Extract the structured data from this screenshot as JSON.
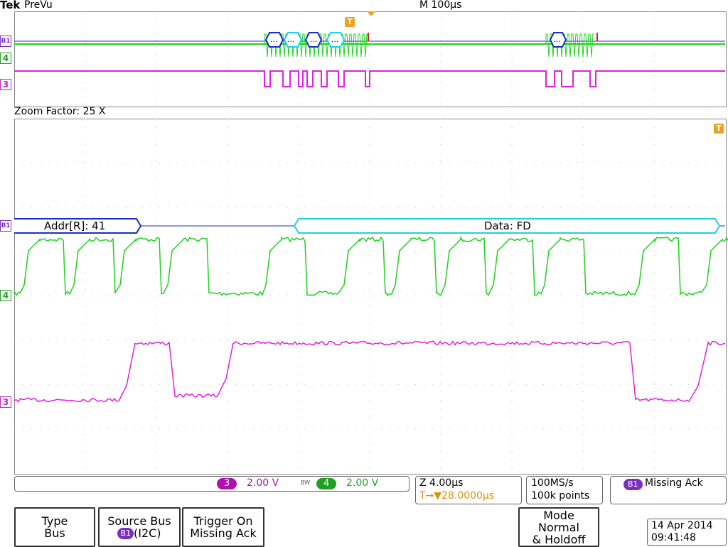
{
  "brand": "Tek",
  "mode_label": "PreVu",
  "timebase": "M 100µs",
  "zoom_factor": "Zoom Factor: 25 X",
  "channel_markers": {
    "b1": "B1",
    "ch4": "4",
    "ch3": "3",
    "trigger": "T"
  },
  "bus_labels": {
    "zoom_addr": "Addr[R]: 41",
    "zoom_data": "Data: FD",
    "overview_packets": [
      "...",
      "...",
      "...",
      "...",
      "..."
    ]
  },
  "readouts": {
    "ch3_badge": "3",
    "ch3_scale": "2.00 V",
    "bw_mark": "BW",
    "ch4_badge": "4",
    "ch4_scale": "2.00 V",
    "zoom_time": "Z 4.00µs",
    "trigger_pos": "T→▼28.0000µs",
    "sample_rate": "100MS/s",
    "record_length": "100k points",
    "bus_badge": "B1",
    "trigger_type": "Missing Ack"
  },
  "softkeys": {
    "type_line1": "Type",
    "type_line2": "Bus",
    "source_line1": "Source Bus",
    "source_badge": "B1",
    "source_line2": "(I2C)",
    "trigger_line1": "Trigger On",
    "trigger_line2": "Missing Ack",
    "mode_line1": "Mode",
    "mode_line2": "Normal",
    "mode_line3": "& Holdoff"
  },
  "datetime": {
    "date": "14 Apr  2014",
    "time": "09:41:48"
  },
  "colors": {
    "ch3": "#e020e0",
    "ch4": "#20d020",
    "bus": "#1a2fc0",
    "data": "#20d0e0",
    "trigger": "#f0a020",
    "badge_purple": "#7a2fc0"
  }
}
